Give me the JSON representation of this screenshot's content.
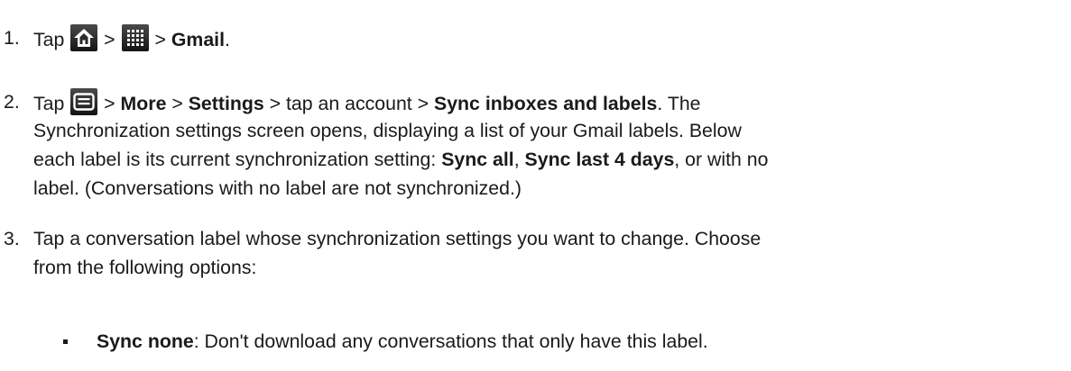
{
  "steps": [
    {
      "number": "1.",
      "tap": "Tap",
      "sep1": " > ",
      "sep2": " > ",
      "app": "Gmail",
      "end": "."
    },
    {
      "number": "2.",
      "tap": "Tap",
      "sep1": " > ",
      "more": "More",
      "sep2": " > ",
      "settings": "Settings",
      "sep3": " > tap an account > ",
      "sync": "Sync inboxes and labels",
      "line1_tail": ". The",
      "line2": "Synchronization settings screen opens, displaying a list of your Gmail labels. Below",
      "line3_a": "each label is its current synchronization setting: ",
      "sync_all": "Sync all",
      "line3_b": ", ",
      "sync_last": "Sync last 4 days",
      "line3_c": ", or with no",
      "line4": "label. (Conversations with no label are not synchronized.)"
    },
    {
      "number": "3.",
      "line1": "Tap a conversation label whose synchronization settings you want to change. Choose",
      "line2": "from the following options:"
    }
  ],
  "options": [
    {
      "label": "Sync none",
      "text": ": Don't download any conversations that only have this label."
    }
  ],
  "icons": [
    "home-icon",
    "apps-grid-icon",
    "menu-icon"
  ]
}
